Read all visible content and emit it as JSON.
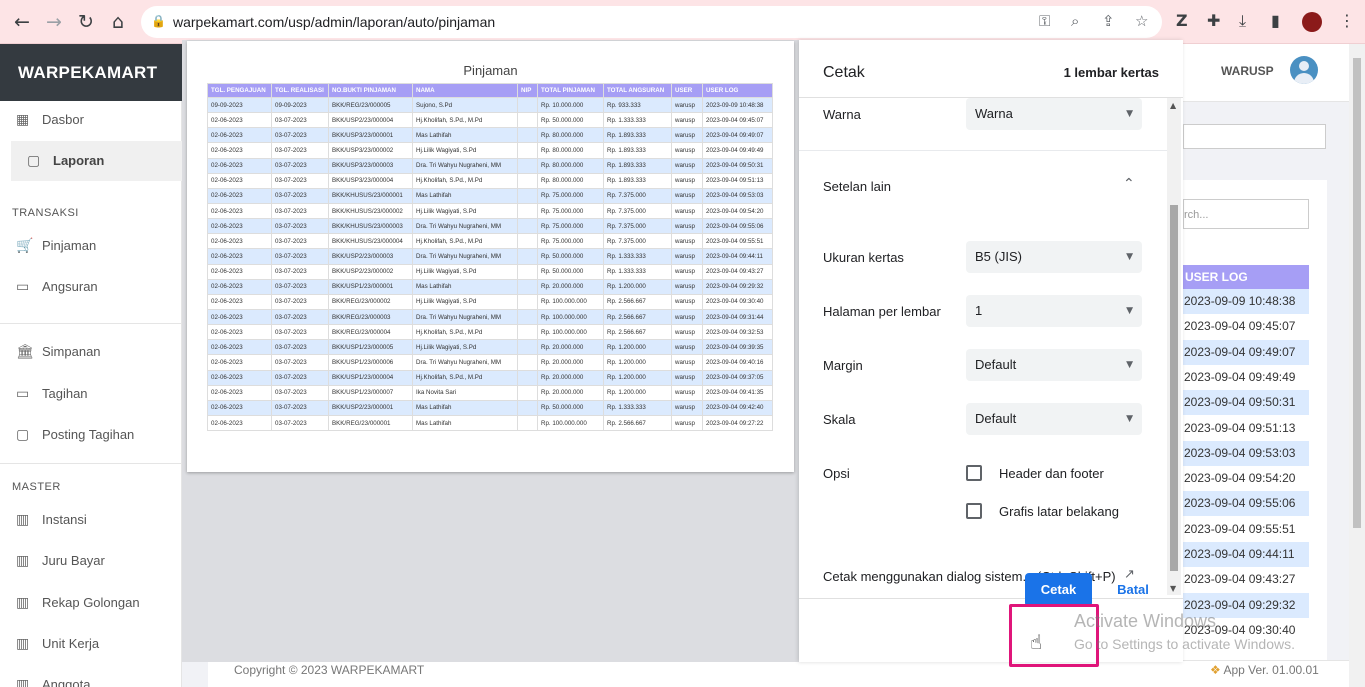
{
  "browser": {
    "url": "warpekamart.com/usp/admin/laporan/auto/pinjaman",
    "back_icon": "←",
    "forward_icon": "→",
    "reload_icon": "↻",
    "home_icon": "⌂",
    "lock_icon": "🔒"
  },
  "app": {
    "brand": "WARPEKAMART",
    "user": "WARUSP",
    "footer": "Copyright © 2023 WARPEKAMART",
    "version": "App Ver. 01.00.01"
  },
  "sidebar": {
    "items_top": [
      {
        "label": "Dasbor",
        "icon": "▦"
      },
      {
        "label": "Laporan",
        "icon": "▢"
      }
    ],
    "section_transaksi": "TRANSAKSI",
    "transaksi": [
      {
        "label": "Pinjaman",
        "icon": "🛒"
      },
      {
        "label": "Angsuran",
        "icon": "▭"
      },
      {
        "label": "Simpanan",
        "icon": "🏛"
      },
      {
        "label": "Tagihan",
        "icon": "▭"
      },
      {
        "label": "Posting Tagihan",
        "icon": "▢"
      }
    ],
    "section_master": "MASTER",
    "master": [
      {
        "label": "Instansi",
        "icon": "▥"
      },
      {
        "label": "Juru Bayar",
        "icon": "▥"
      },
      {
        "label": "Rekap Golongan",
        "icon": "▥"
      },
      {
        "label": "Unit Kerja",
        "icon": "▥"
      },
      {
        "label": "Anggota",
        "icon": "▥"
      }
    ]
  },
  "background": {
    "search_placeholder": "rch...",
    "header": "USER LOG",
    "rows": [
      "2023-09-09 10:48:38",
      "2023-09-04 09:45:07",
      "2023-09-04 09:49:07",
      "2023-09-04 09:49:49",
      "2023-09-04 09:50:31",
      "2023-09-04 09:51:13",
      "2023-09-04 09:53:03",
      "2023-09-04 09:54:20",
      "2023-09-04 09:55:06",
      "2023-09-04 09:55:51",
      "2023-09-04 09:44:11",
      "2023-09-04 09:43:27",
      "2023-09-04 09:29:32",
      "2023-09-04 09:30:40"
    ]
  },
  "preview": {
    "title": "Pinjaman",
    "columns": [
      "TGL. PENGAJUAN",
      "TGL. REALISASI",
      "NO.BUKTI PINJAMAN",
      "NAMA",
      "NIP",
      "TOTAL PINJAMAN",
      "TOTAL ANGSURAN",
      "USER",
      "USER LOG"
    ],
    "rows": [
      [
        "09-09-2023",
        "09-09-2023",
        "BKK/REG/23/000005",
        "Sujono, S.Pd",
        "",
        "Rp. 10.000.000",
        "Rp. 933.333",
        "warusp",
        "2023-09-09 10:48:38"
      ],
      [
        "02-06-2023",
        "03-07-2023",
        "BKK/USP2/23/000004",
        "Hj.Kholifah, S.Pd., M.Pd",
        "",
        "Rp. 50.000.000",
        "Rp. 1.333.333",
        "warusp",
        "2023-09-04 09:45:07"
      ],
      [
        "02-06-2023",
        "03-07-2023",
        "BKK/USP3/23/000001",
        "Mas Lathifah",
        "",
        "Rp. 80.000.000",
        "Rp. 1.893.333",
        "warusp",
        "2023-09-04 09:49:07"
      ],
      [
        "02-06-2023",
        "03-07-2023",
        "BKK/USP3/23/000002",
        "Hj.Lilik Wagiyati, S.Pd",
        "",
        "Rp. 80.000.000",
        "Rp. 1.893.333",
        "warusp",
        "2023-09-04 09:49:49"
      ],
      [
        "02-06-2023",
        "03-07-2023",
        "BKK/USP3/23/000003",
        "Dra. Tri Wahyu Nugraheni, MM",
        "",
        "Rp. 80.000.000",
        "Rp. 1.893.333",
        "warusp",
        "2023-09-04 09:50:31"
      ],
      [
        "02-06-2023",
        "03-07-2023",
        "BKK/USP3/23/000004",
        "Hj.Kholifah, S.Pd., M.Pd",
        "",
        "Rp. 80.000.000",
        "Rp. 1.893.333",
        "warusp",
        "2023-09-04 09:51:13"
      ],
      [
        "02-06-2023",
        "03-07-2023",
        "BKK/KHUSUS/23/000001",
        "Mas Lathifah",
        "",
        "Rp. 75.000.000",
        "Rp. 7.375.000",
        "warusp",
        "2023-09-04 09:53:03"
      ],
      [
        "02-06-2023",
        "03-07-2023",
        "BKK/KHUSUS/23/000002",
        "Hj.Lilik Wagiyati, S.Pd",
        "",
        "Rp. 75.000.000",
        "Rp. 7.375.000",
        "warusp",
        "2023-09-04 09:54:20"
      ],
      [
        "02-06-2023",
        "03-07-2023",
        "BKK/KHUSUS/23/000003",
        "Dra. Tri Wahyu Nugraheni, MM",
        "",
        "Rp. 75.000.000",
        "Rp. 7.375.000",
        "warusp",
        "2023-09-04 09:55:06"
      ],
      [
        "02-06-2023",
        "03-07-2023",
        "BKK/KHUSUS/23/000004",
        "Hj.Kholifah, S.Pd., M.Pd",
        "",
        "Rp. 75.000.000",
        "Rp. 7.375.000",
        "warusp",
        "2023-09-04 09:55:51"
      ],
      [
        "02-06-2023",
        "03-07-2023",
        "BKK/USP2/23/000003",
        "Dra. Tri Wahyu Nugraheni, MM",
        "",
        "Rp. 50.000.000",
        "Rp. 1.333.333",
        "warusp",
        "2023-09-04 09:44:11"
      ],
      [
        "02-06-2023",
        "03-07-2023",
        "BKK/USP2/23/000002",
        "Hj.Lilik Wagiyati, S.Pd",
        "",
        "Rp. 50.000.000",
        "Rp. 1.333.333",
        "warusp",
        "2023-09-04 09:43:27"
      ],
      [
        "02-06-2023",
        "03-07-2023",
        "BKK/USP1/23/000001",
        "Mas Lathifah",
        "",
        "Rp. 20.000.000",
        "Rp. 1.200.000",
        "warusp",
        "2023-09-04 09:29:32"
      ],
      [
        "02-06-2023",
        "03-07-2023",
        "BKK/REG/23/000002",
        "Hj.Lilik Wagiyati, S.Pd",
        "",
        "Rp. 100.000.000",
        "Rp. 2.566.667",
        "warusp",
        "2023-09-04 09:30:40"
      ],
      [
        "02-06-2023",
        "03-07-2023",
        "BKK/REG/23/000003",
        "Dra. Tri Wahyu Nugraheni, MM",
        "",
        "Rp. 100.000.000",
        "Rp. 2.566.667",
        "warusp",
        "2023-09-04 09:31:44"
      ],
      [
        "02-06-2023",
        "03-07-2023",
        "BKK/REG/23/000004",
        "Hj.Kholifah, S.Pd., M.Pd",
        "",
        "Rp. 100.000.000",
        "Rp. 2.566.667",
        "warusp",
        "2023-09-04 09:32:53"
      ],
      [
        "02-06-2023",
        "03-07-2023",
        "BKK/USP1/23/000005",
        "Hj.Lilik Wagiyati, S.Pd",
        "",
        "Rp. 20.000.000",
        "Rp. 1.200.000",
        "warusp",
        "2023-09-04 09:39:35"
      ],
      [
        "02-06-2023",
        "03-07-2023",
        "BKK/USP1/23/000006",
        "Dra. Tri Wahyu Nugraheni, MM",
        "",
        "Rp. 20.000.000",
        "Rp. 1.200.000",
        "warusp",
        "2023-09-04 09:40:16"
      ],
      [
        "02-06-2023",
        "03-07-2023",
        "BKK/USP1/23/000004",
        "Hj.Kholifah, S.Pd., M.Pd",
        "",
        "Rp. 20.000.000",
        "Rp. 1.200.000",
        "warusp",
        "2023-09-04 09:37:05"
      ],
      [
        "02-06-2023",
        "03-07-2023",
        "BKK/USP1/23/000007",
        "Ika Novita Sari",
        "",
        "Rp. 20.000.000",
        "Rp. 1.200.000",
        "warusp",
        "2023-09-04 09:41:35"
      ],
      [
        "02-06-2023",
        "03-07-2023",
        "BKK/USP2/23/000001",
        "Mas Lathifah",
        "",
        "Rp. 50.000.000",
        "Rp. 1.333.333",
        "warusp",
        "2023-09-04 09:42:40"
      ],
      [
        "02-06-2023",
        "03-07-2023",
        "BKK/REG/23/000001",
        "Mas Lathifah",
        "",
        "Rp. 100.000.000",
        "Rp. 2.566.667",
        "warusp",
        "2023-09-04 09:27:22"
      ]
    ]
  },
  "print_dialog": {
    "title": "Cetak",
    "sheets": "1 lembar kertas",
    "color_label": "Warna",
    "color_value": "Warna",
    "more_settings": "Setelan lain",
    "paper_label": "Ukuran kertas",
    "paper_value": "B5 (JIS)",
    "pages_label": "Halaman per lembar",
    "pages_value": "1",
    "margin_label": "Margin",
    "margin_value": "Default",
    "scale_label": "Skala",
    "scale_value": "Default",
    "options_label": "Opsi",
    "opt_header": "Header dan footer",
    "opt_bg": "Grafis latar belakang",
    "system_dialog": "Cetak menggunakan dialog sistem... (Ctrl+Shift+P)",
    "print_button": "Cetak",
    "cancel_button": "Batal"
  },
  "watermark": {
    "line1": "Activate Windows",
    "line2": "Go to Settings to activate Windows."
  }
}
